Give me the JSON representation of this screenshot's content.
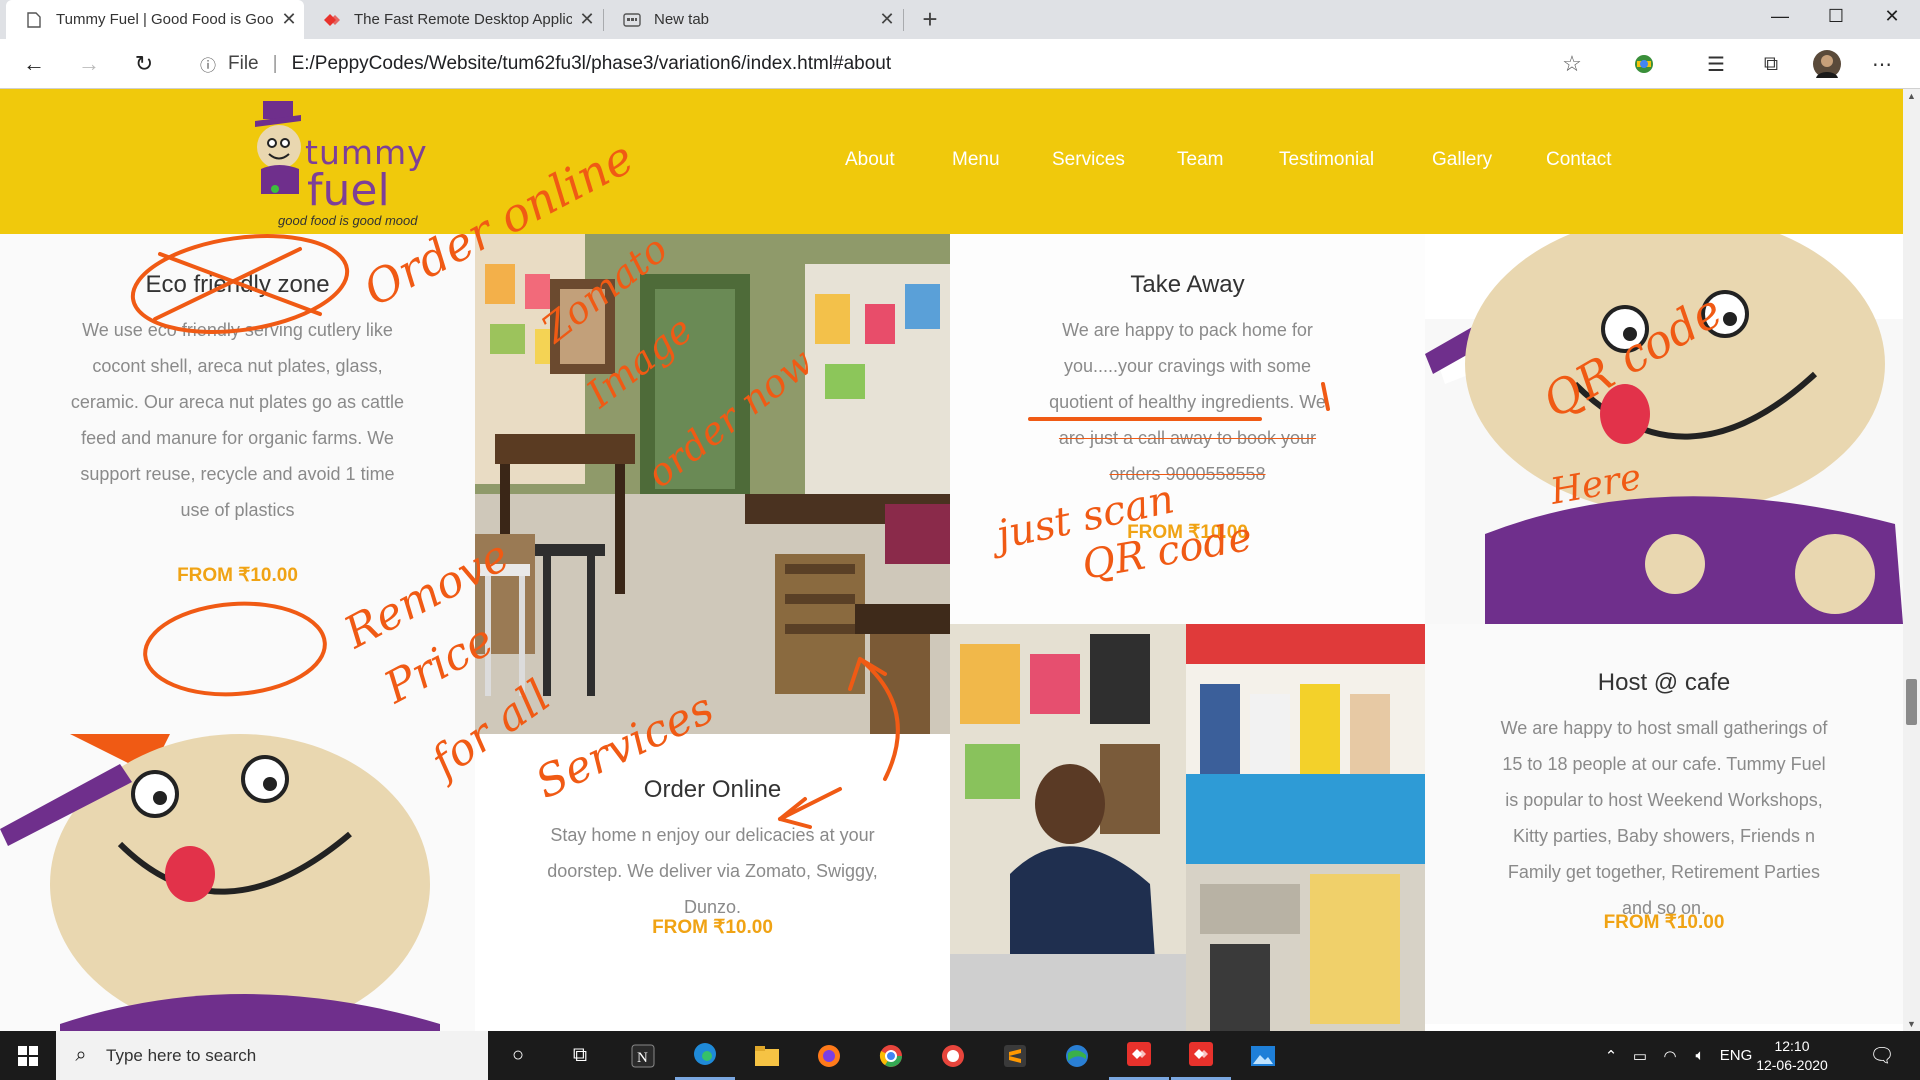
{
  "browser": {
    "tabs": [
      {
        "title": "Tummy Fuel | Good Food is Goo",
        "active": true
      },
      {
        "title": "The Fast Remote Desktop Applic",
        "active": false
      },
      {
        "title": "New tab",
        "active": false
      }
    ],
    "close_glyph": "✕",
    "new_tab_glyph": "+",
    "window_controls": {
      "minimize": "—",
      "maximize": "☐",
      "close": "✕"
    },
    "address": {
      "scheme_label": "File",
      "separator": "|",
      "url": "E:/PeppyCodes/Website/tum62fu3l/phase3/variation6/index.html#about"
    }
  },
  "site": {
    "logo": {
      "word1": "tummy",
      "word2": "fuel",
      "tagline": "good food is good mood"
    },
    "nav": [
      "About",
      "Menu",
      "Services",
      "Team",
      "Testimonial",
      "Gallery",
      "Contact"
    ],
    "services": [
      {
        "title": "Eco friendly zone",
        "text": "We use eco friendly serving cutlery like cocont shell, areca nut plates, glass, ceramic. Our areca nut plates go as cattle feed and manure for organic farms. We support reuse, recycle and avoid 1 time use of plastics",
        "price": "FROM ₹10.00"
      },
      {
        "title": "Take Away",
        "text_lines": [
          "We are happy to pack home for",
          "you.....your cravings with some",
          "quotient of healthy ingredients. We",
          "are just a call away to book your",
          "orders 9000558558"
        ],
        "price": "FROM ₹10.00"
      },
      {
        "title": "Order Online",
        "text": "Stay home n enjoy our delicacies at your doorstep. We deliver via Zomato, Swiggy, Dunzo.",
        "price": "FROM ₹10.00"
      },
      {
        "title": "Host @ cafe",
        "text": "We are happy to host small gatherings of 15 to 18 people at our cafe. Tummy Fuel is popular to host Weekend Workshops, Kitty parties, Baby showers, Friends n Family get together, Retirement Parties and so on.",
        "price": "FROM ₹10.00"
      }
    ]
  },
  "annotations": {
    "order_online": "Order online",
    "zomato": "Zomato",
    "image": "Image",
    "order_now": "order now",
    "qr_code": "QR code",
    "here": "Here",
    "just_scan": "just scan",
    "qr_code2": "QR code",
    "remove": "Remove",
    "price": "Price",
    "for_all": "for all",
    "services": "Services",
    "color": "#f05a14"
  },
  "taskbar": {
    "search_placeholder": "Type here to search",
    "language": "ENG",
    "time": "12:10",
    "date": "12-06-2020"
  }
}
